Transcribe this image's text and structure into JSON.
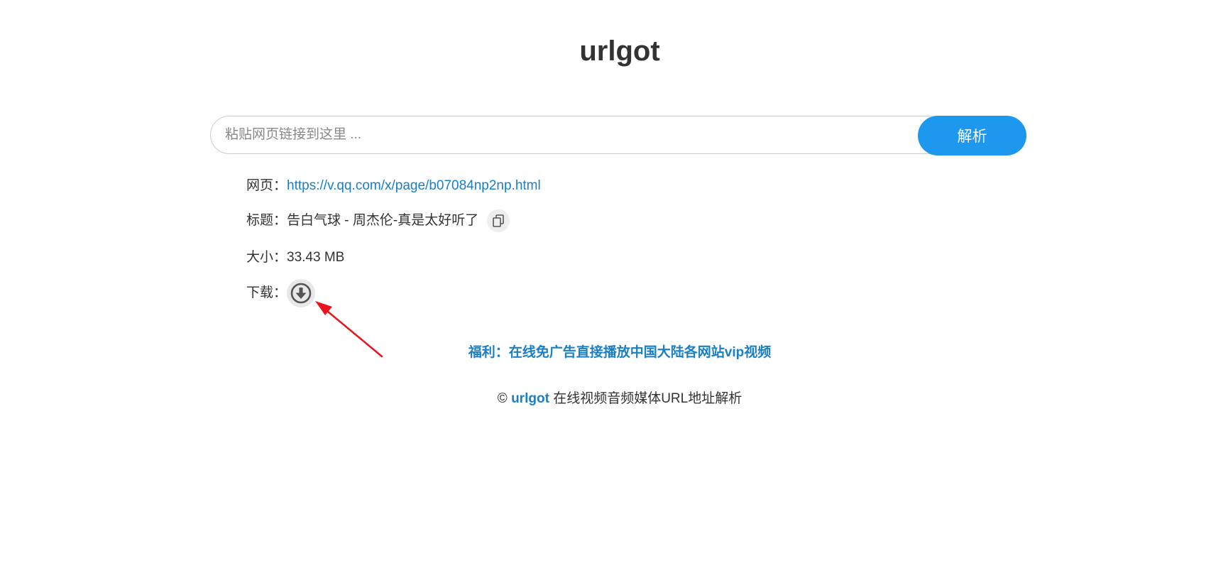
{
  "header": {
    "title": "urlgot"
  },
  "search": {
    "placeholder": "粘贴网页链接到这里 ...",
    "value": "",
    "button_label": "解析"
  },
  "result": {
    "page_label": "网页：",
    "page_url": "https://v.qq.com/x/page/b07084np2np.html",
    "title_label": "标题：",
    "title_value": "告白气球 - 周杰伦-真是太好听了",
    "size_label": "大小：",
    "size_value": "33.43 MB",
    "download_label": "下载："
  },
  "promo": {
    "text": "福利：在线免广告直接播放中国大陆各网站vip视频"
  },
  "footer": {
    "copyright": "©",
    "brand": "urlgot",
    "tagline": "在线视频音频媒体URL地址解析"
  },
  "icons": {
    "copy": "copy-icon",
    "download": "download-icon",
    "annotation": "red-arrow-icon"
  },
  "colors": {
    "accent": "#1e98ef",
    "link": "#1a7fc4",
    "annotation": "#e8161c"
  }
}
